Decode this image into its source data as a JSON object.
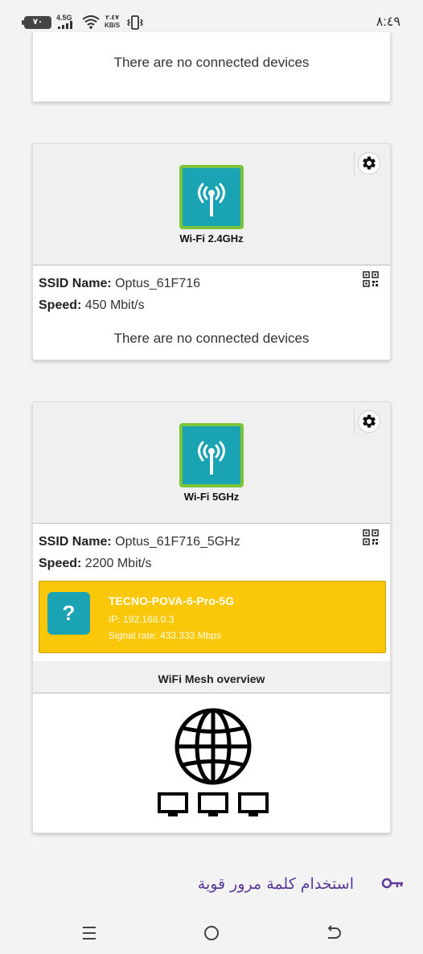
{
  "status_bar": {
    "battery": "٧٠",
    "network_type": "4.5G",
    "speed_value": "٢.٤٧",
    "speed_unit": "KB/S",
    "time": "٨:٤٩"
  },
  "top_card": {
    "no_devices_text": "There are no connected devices"
  },
  "band_24": {
    "label": "Wi-Fi 2.4GHz",
    "ssid_label": "SSID Name:",
    "ssid_value": "Optus_61F716",
    "speed_label": "Speed:",
    "speed_value": "450 Mbit/s",
    "no_devices_text": "There are no connected devices"
  },
  "band_5": {
    "label": "Wi-Fi 5GHz",
    "ssid_label": "SSID Name:",
    "ssid_value": "Optus_61F716_5GHz",
    "speed_label": "Speed:",
    "speed_value": "2200 Mbit/s",
    "device": {
      "icon_text": "?",
      "name": "TECNO-POVA-6-Pro-5G",
      "ip": "IP: 192.168.0.3",
      "signal_rate": "Signal rate: 433.333 Mbps"
    },
    "mesh_title": "WiFi Mesh overview"
  },
  "suggestion": {
    "text": "استخدام كلمة مرور قوية"
  },
  "colors": {
    "tile_teal": "#1aa3b3",
    "tile_border_green": "#7cc43a",
    "device_yellow": "#fbc809",
    "suggest_purple": "#5b3a9a"
  },
  "icons": [
    "gear-icon",
    "qr-code-icon",
    "wifi-antenna-icon",
    "globe-network-icon",
    "key-icon",
    "menu-icon",
    "home-icon",
    "back-icon"
  ]
}
